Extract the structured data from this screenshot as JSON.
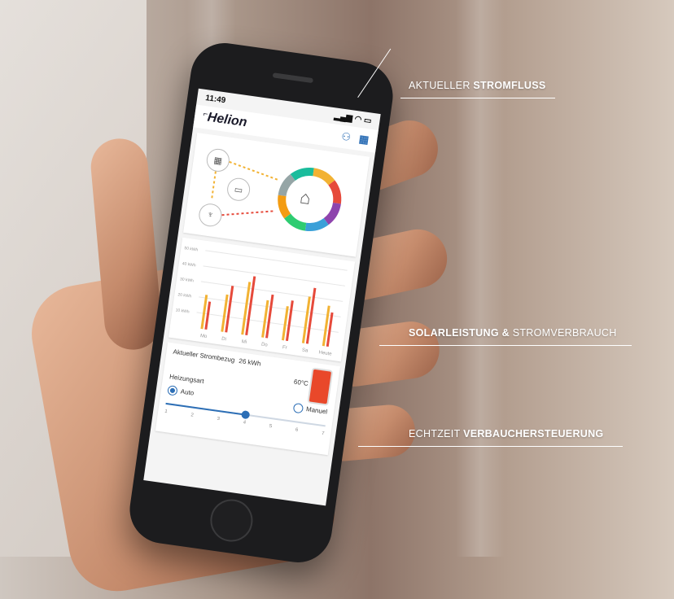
{
  "phone": {
    "status_time": "11:49",
    "status_icons": "signal-wifi-battery-icons",
    "brand": "Helion",
    "header_icons": [
      "user-icon",
      "solar-panel-icon"
    ]
  },
  "flow_card": {
    "nodes": [
      "solar-panel-icon",
      "battery-icon",
      "power-mast-icon",
      "house-icon"
    ],
    "ring_colors": [
      "#f2b233",
      "#e64a3b",
      "#8e44ad",
      "#3aa0d8",
      "#2ecc71",
      "#f39c12",
      "#95a5a6",
      "#1abc9c"
    ]
  },
  "chart_data": {
    "type": "bar",
    "categories": [
      "Mo",
      "Di",
      "Mi",
      "Do",
      "Fr",
      "Sa",
      "Heute"
    ],
    "y_ticks": [
      "50 kWh",
      "40 kWh",
      "30 kWh",
      "20 kWh",
      "10 kWh"
    ],
    "ylim": [
      0,
      50
    ],
    "series": [
      {
        "values": [
          22,
          24,
          34,
          24,
          22,
          30,
          26
        ],
        "color": "#f2b233"
      },
      {
        "values": [
          18,
          30,
          38,
          28,
          26,
          36,
          22
        ],
        "color": "#e64a3b"
      }
    ]
  },
  "control_card": {
    "consumption_label": "Aktueller Strombezug",
    "consumption_value": "26 kWh",
    "temperature": "60°C",
    "heating_label": "Heizungsart",
    "option_auto": "Auto",
    "option_manual": "Manuel",
    "slider_ticks": [
      "1",
      "2",
      "3",
      "4",
      "5",
      "6",
      "7"
    ],
    "slider_value": 4
  },
  "callouts": {
    "flow": {
      "normal": "AKTUELLER ",
      "bold": "STROMFLUSS"
    },
    "chart": {
      "bold": "SOLARLEISTUNG &",
      "normal": " STROMVERBRAUCH"
    },
    "ctrl": {
      "normal": "ECHTZEIT ",
      "bold": "VERBAUCHERSTEUERUNG"
    }
  }
}
